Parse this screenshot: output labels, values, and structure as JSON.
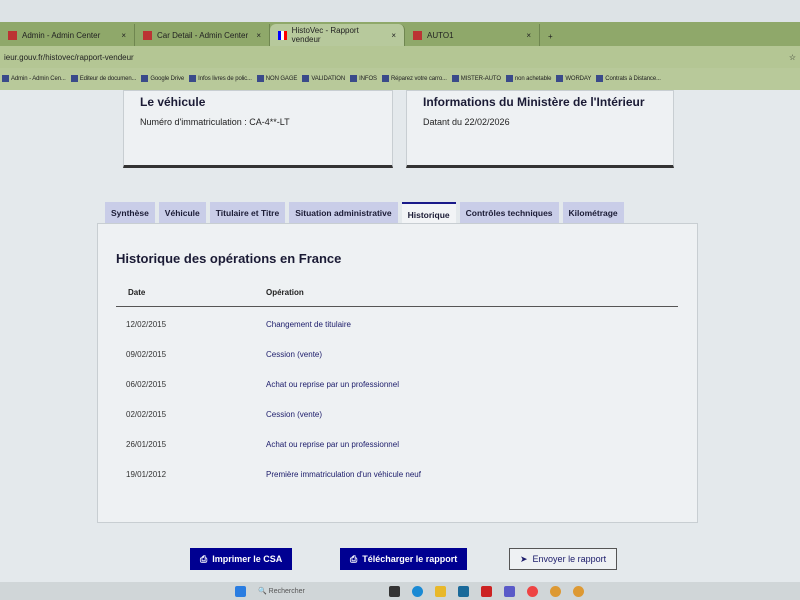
{
  "browser": {
    "tabs": [
      {
        "label": "Admin - Admin Center"
      },
      {
        "label": "Car Detail - Admin Center"
      },
      {
        "label": "HistoVec - Rapport vendeur",
        "active": true
      },
      {
        "label": "AUTO1"
      }
    ],
    "url": "ieur.gouv.fr/histovec/rapport-vendeur",
    "bookmarks": [
      "Admin - Admin Cen...",
      "Editeur de documen...",
      "Google Drive",
      "Infos livres de polic...",
      "NON GAGE",
      "VALIDATION",
      "INFOS",
      "Réparez votre carro...",
      "MISTER-AUTO",
      "non achetable",
      "WORDAY",
      "Contrats à Distance..."
    ]
  },
  "vehicle_card": {
    "title": "Le véhicule",
    "plate_text": "Numéro d'immatriculation : CA-4**-LT"
  },
  "ministry_card": {
    "title": "Informations du Ministère de l'Intérieur",
    "date_text": "Datant du 22/02/2026"
  },
  "tabs": [
    "Synthèse",
    "Véhicule",
    "Titulaire et Titre",
    "Situation administrative",
    "Historique",
    "Contrôles techniques",
    "Kilométrage"
  ],
  "history": {
    "title": "Historique des opérations en France",
    "col_date": "Date",
    "col_operation": "Opération",
    "rows": [
      {
        "date": "12/02/2015",
        "operation": "Changement de titulaire"
      },
      {
        "date": "09/02/2015",
        "operation": "Cession (vente)"
      },
      {
        "date": "06/02/2015",
        "operation": "Achat ou reprise par un professionnel"
      },
      {
        "date": "02/02/2015",
        "operation": "Cession (vente)"
      },
      {
        "date": "26/01/2015",
        "operation": "Achat ou reprise par un professionnel"
      },
      {
        "date": "19/01/2012",
        "operation": "Première immatriculation d'un véhicule neuf"
      }
    ]
  },
  "actions": {
    "print": "Imprimer le CSA",
    "download": "Télécharger le rapport",
    "send": "Envoyer le rapport"
  },
  "taskbar": {
    "search": "Rechercher"
  },
  "colors": {
    "primary": "#000091",
    "tab_bg": "#c9cde8"
  }
}
